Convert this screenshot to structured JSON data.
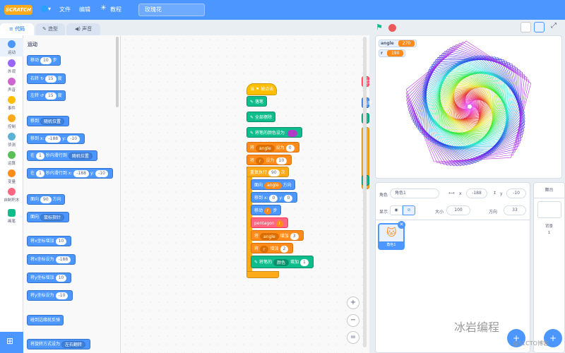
{
  "menubar": {
    "logo": "SCRATCH",
    "file": "文件",
    "edit": "编辑",
    "tutorials": "教程",
    "project_title": "玫瑰花"
  },
  "tabs": {
    "code": "代码",
    "costumes": "造型",
    "sounds": "声音"
  },
  "categories": [
    {
      "label": "运动",
      "color": "#4c97ff"
    },
    {
      "label": "外观",
      "color": "#9966ff"
    },
    {
      "label": "声音",
      "color": "#cf63cf"
    },
    {
      "label": "事件",
      "color": "#ffbf00"
    },
    {
      "label": "控制",
      "color": "#ffab19"
    },
    {
      "label": "侦测",
      "color": "#5cb1d6"
    },
    {
      "label": "运算",
      "color": "#59c059"
    },
    {
      "label": "变量",
      "color": "#ff8c1a"
    },
    {
      "label": "自制积木",
      "color": "#ff6680"
    },
    {
      "label": "画笔",
      "color": "#0fbd8c"
    }
  ],
  "palette": {
    "title": "运动",
    "move": {
      "pre": "移动",
      "val": "10",
      "post": "步"
    },
    "turn_right": {
      "pre": "右转",
      "val": "15",
      "post": "度"
    },
    "turn_left": {
      "pre": "左转",
      "val": "15",
      "post": "度"
    },
    "goto": {
      "pre": "移到",
      "dd": "随机位置"
    },
    "gotoxy": {
      "pre": "移到 x:",
      "x": "-188",
      "mid": "y:",
      "y": "-10"
    },
    "glide_random": {
      "pre": "在",
      "val": "1",
      "mid": "秒内滑行到",
      "dd": "随机位置"
    },
    "glide_xy": {
      "pre": "在",
      "val": "1",
      "mid": "秒内滑行到 x:",
      "x": "-188",
      "ymid": "y:",
      "y": "-10"
    },
    "point_dir": {
      "pre": "面向",
      "val": "90",
      "post": "方向"
    },
    "point_toward": {
      "pre": "面向",
      "dd": "鼠标指针"
    },
    "change_x": {
      "pre": "将x坐标增加",
      "val": "10"
    },
    "set_x": {
      "pre": "将x坐标设为",
      "val": "-188"
    },
    "change_y": {
      "pre": "将y坐标增加",
      "val": "10"
    },
    "set_y": {
      "pre": "将y坐标设为",
      "val": "-10"
    },
    "bounce": "碰到边缘就反弹",
    "rotation": {
      "pre": "将旋转方式设为",
      "dd": "左右翻转"
    }
  },
  "script": {
    "hat": "当 ⚑ 被点击",
    "pen_down": "落笔",
    "clear": "全部擦除",
    "set_pen_color": "将笔的颜色设为",
    "set_angle": {
      "pre": "将",
      "var": "angle",
      "mid": "设为",
      "val": "0"
    },
    "set_r": {
      "pre": "将",
      "var": "r",
      "mid": "设为",
      "val": "10"
    },
    "repeat": {
      "pre": "重复执行",
      "val": "90",
      "post": "次"
    },
    "face": {
      "pre": "面向",
      "var": "angle",
      "post": "方向"
    },
    "gotoxy": {
      "pre": "移到 x:",
      "x": "0",
      "mid": "y:",
      "y": "0"
    },
    "move": {
      "pre": "移动",
      "var": "r",
      "post": "步"
    },
    "pentagon": {
      "pre": "pentagon",
      "var": "r"
    },
    "change_angle": {
      "pre": "将",
      "var": "angle",
      "mid": "增加",
      "val": "3"
    },
    "change_r": {
      "pre": "将",
      "var": "r",
      "mid": "增加",
      "val": "2"
    },
    "change_pen": {
      "pre": "将笔的",
      "dd": "颜色",
      "mid": "增加",
      "val": "1"
    },
    "side_labels": [
      "定义",
      "右转",
      "",
      "",
      "",
      ""
    ]
  },
  "zoom": {
    "in": "+",
    "out": "−",
    "reset": "="
  },
  "monitors": [
    {
      "name": "angle",
      "value": "270"
    },
    {
      "name": "r",
      "value": "190"
    }
  ],
  "sprite_info": {
    "sprite_label": "角色",
    "sprite_name": "角色1",
    "x_label": "x",
    "x": "-188",
    "y_label": "y",
    "y": "-10",
    "show_label": "显示",
    "size_label": "大小",
    "size": "100",
    "dir_label": "方向",
    "dir": "33",
    "card_name": "角色1"
  },
  "stage_panel": {
    "title": "舞台",
    "backdrops_label": "背景",
    "backdrops_count": "1"
  },
  "watermark": {
    "line1": "冰岩编程",
    "line2": "@51CTO博客"
  },
  "colors": {
    "accent": "#4c97ff",
    "event": "#ffbf00",
    "pen": "#0fbd8c",
    "variable": "#ff8c1a",
    "control": "#ffab19",
    "custom": "#ff6680"
  }
}
